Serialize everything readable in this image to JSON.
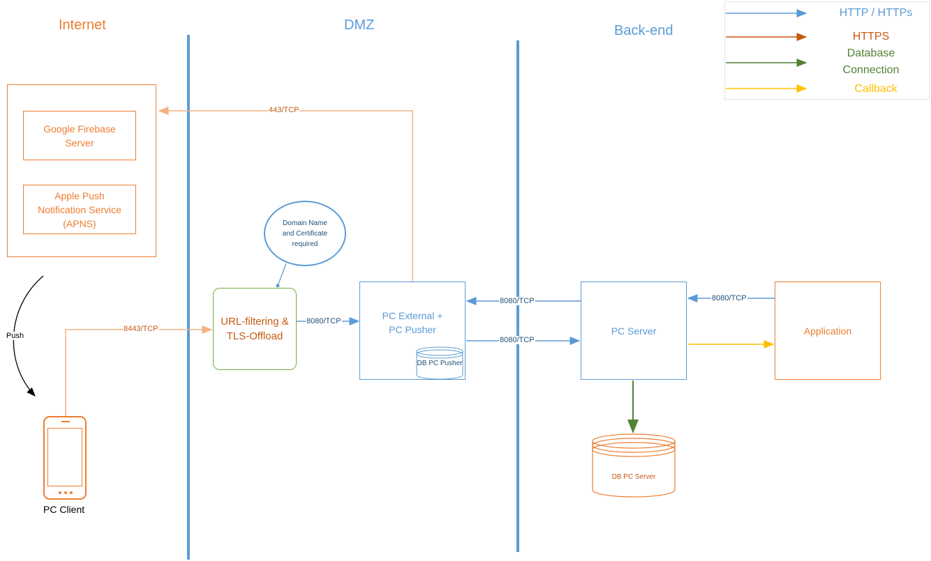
{
  "zones": {
    "internet": "Internet",
    "dmz": "DMZ",
    "backend": "Back-end"
  },
  "legend": [
    {
      "label": "HTTP / HTTPs",
      "color": "#5B9BD5"
    },
    {
      "label": "HTTPS",
      "color": "#C55A11"
    },
    {
      "label": "Database\nConnection",
      "color": "#538135"
    },
    {
      "label": "Callback",
      "color": "#FFC000"
    }
  ],
  "nodes": {
    "firebase": "Google Firebase Server",
    "apns": "Apple Push Notification Service (APNS)",
    "push_label": "Push",
    "pc_client": "PC Client",
    "callout": "Domain Name and Certificate required",
    "url_filter": "URL-filtering & TLS-Offload",
    "pc_external": "PC External + PC Pusher",
    "db_pc_pusher": "DB PC Pusher",
    "pc_server": "PC Server",
    "db_pc_server": "DB PC Server",
    "application": "Application"
  },
  "connections": {
    "c443": "443/TCP",
    "c8443": "8443/TCP",
    "c8080_a": "8080/TCP",
    "c8080_b": "8080/TCP",
    "c8080_c": "8080/TCP",
    "c8080_d": "8080/TCP"
  },
  "colors": {
    "orange": "#ED7D31",
    "orange_light": "#F4B183",
    "blue": "#5B9BD5",
    "green": "#538135",
    "green_box": "#70AD47",
    "yellow": "#FFC000",
    "dark_orange": "#C55A11"
  }
}
